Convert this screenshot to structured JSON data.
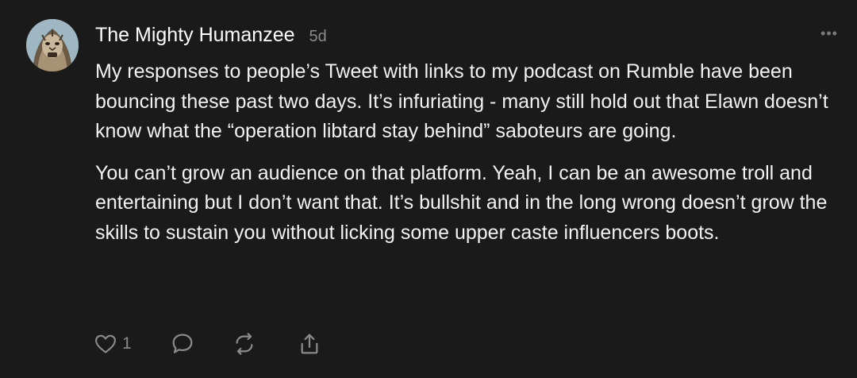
{
  "post": {
    "author": "The Mighty Humanzee",
    "time": "5d",
    "more_label": "•••",
    "paragraphs": [
      "My responses to people’s Tweet with links to my podcast on Rumble have been bouncing these past two days. It’s infuriating - many still hold out that Elawn doesn’t know what the “operation libtard stay behind” saboteurs are going.",
      "You can’t grow an audience on that platform. Yeah, I can be an awesome troll and entertaining but I don’t want that. It’s bullshit and in the long wrong doesn’t grow the skills to sustain you without licking some upper caste influencers boots."
    ]
  },
  "actions": {
    "like_count": "1",
    "icons": [
      "heart-icon",
      "comment-icon",
      "restack-icon",
      "share-icon"
    ]
  },
  "colors": {
    "background": "#1a1a1a",
    "text": "#f2f2f2",
    "muted": "#8a8a8a"
  }
}
